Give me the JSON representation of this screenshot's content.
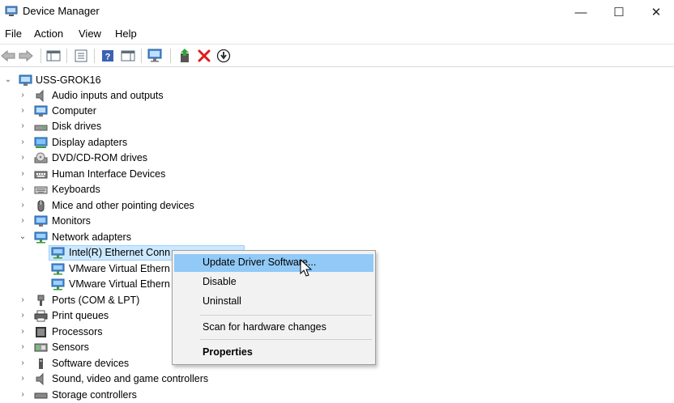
{
  "window": {
    "title": "Device Manager",
    "min_glyph": "—",
    "max_glyph": "☐",
    "close_glyph": "✕"
  },
  "menu": [
    "File",
    "Action",
    "View",
    "Help"
  ],
  "toolbar_icons": [
    "back-icon",
    "forward-icon",
    "show-hide-console-tree-icon",
    "properties-icon",
    "help-icon",
    "action-pane-icon",
    "scan-for-hardware-icon",
    "update-driver-icon",
    "uninstall-icon",
    "disable-icon"
  ],
  "tree": {
    "root": "USS-GROK16",
    "categories": [
      {
        "label": "Audio inputs and outputs",
        "icon": "speaker-icon",
        "expanded": false
      },
      {
        "label": "Computer",
        "icon": "computer-icon",
        "expanded": false
      },
      {
        "label": "Disk drives",
        "icon": "disk-drive-icon",
        "expanded": false
      },
      {
        "label": "Display adapters",
        "icon": "display-adapter-icon",
        "expanded": false
      },
      {
        "label": "DVD/CD-ROM drives",
        "icon": "dvd-drive-icon",
        "expanded": false
      },
      {
        "label": "Human Interface Devices",
        "icon": "hid-icon",
        "expanded": false
      },
      {
        "label": "Keyboards",
        "icon": "keyboard-icon",
        "expanded": false
      },
      {
        "label": "Mice and other pointing devices",
        "icon": "mouse-icon",
        "expanded": false
      },
      {
        "label": "Monitors",
        "icon": "monitor-icon",
        "expanded": false
      },
      {
        "label": "Network adapters",
        "icon": "network-icon",
        "expanded": true
      },
      {
        "label": "Ports (COM & LPT)",
        "icon": "port-icon",
        "expanded": false
      },
      {
        "label": "Print queues",
        "icon": "printer-icon",
        "expanded": false
      },
      {
        "label": "Processors",
        "icon": "processor-icon",
        "expanded": false
      },
      {
        "label": "Sensors",
        "icon": "sensor-icon",
        "expanded": false
      },
      {
        "label": "Software devices",
        "icon": "software-device-icon",
        "expanded": false
      },
      {
        "label": "Sound, video and game controllers",
        "icon": "speaker-icon",
        "expanded": false
      },
      {
        "label": "Storage controllers",
        "icon": "storage-controller-icon",
        "expanded": false
      }
    ],
    "network_children": [
      {
        "label": "Intel(R) Ethernet Conn",
        "selected": true
      },
      {
        "label": "VMware Virtual Ethern",
        "selected": false
      },
      {
        "label": "VMware Virtual Ethern",
        "selected": false
      }
    ]
  },
  "context_menu": {
    "items": [
      {
        "label": "Update Driver Software...",
        "highlighted": true,
        "bold": false
      },
      {
        "label": "Disable",
        "highlighted": false,
        "bold": false
      },
      {
        "label": "Uninstall",
        "highlighted": false,
        "bold": false
      },
      {
        "label": "Scan for hardware changes",
        "highlighted": false,
        "bold": false
      },
      {
        "label": "Properties",
        "highlighted": false,
        "bold": true
      }
    ]
  },
  "colors": {
    "selection": "#cce8ff",
    "menu_highlight": "#91c9f7",
    "menu_bg": "#f2f2f2"
  }
}
